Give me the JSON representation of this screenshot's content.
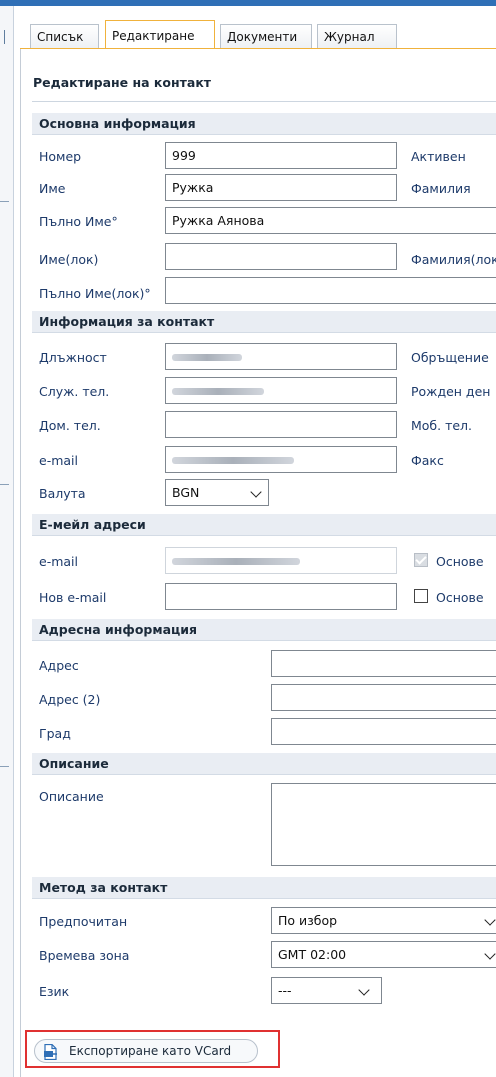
{
  "tabs": [
    "Списък",
    "Редактиране",
    "Документи",
    "Журнал"
  ],
  "page_title": "Редактиране на контакт",
  "sections": {
    "basic": "Основна информация",
    "contact": "Информация за контакт",
    "emails": "Е-мейл адреси",
    "address": "Адресна информация",
    "description": "Описание",
    "contact_method": "Метод за контакт"
  },
  "basic": {
    "number_label": "Номер",
    "number_value": "999",
    "active_label": "Активен",
    "first_name_label": "Име",
    "first_name_value": "Ружка",
    "last_name_label": "Фамилия",
    "full_name_label": "Пълно Име°",
    "full_name_value": "Ружка Аянова",
    "first_name_loc_label": "Име(лок)",
    "first_name_loc_value": "",
    "last_name_loc_label": "Фамилия(лок",
    "full_name_loc_label": "Пълно Име(лок)°",
    "full_name_loc_value": ""
  },
  "contact": {
    "position_label": "Длъжност",
    "salutation_label": "Обръщение",
    "work_phone_label": "Служ. тел.",
    "birthday_label": "Рожден ден",
    "home_phone_label": "Дом. тел.",
    "home_phone_value": "",
    "mobile_label": "Моб. тел.",
    "email_label": "e-mail",
    "fax_label": "Факс",
    "currency_label": "Валута",
    "currency_value": "BGN"
  },
  "emails": {
    "email_label": "e-mail",
    "primary_label": "Основе",
    "primary_checked": true,
    "new_email_label": "Нов e-mail",
    "new_email_value": "",
    "new_primary_label": "Основе",
    "new_primary_checked": false
  },
  "address": {
    "address_label": "Адрес",
    "address_value": "",
    "address2_label": "Адрес (2)",
    "address2_value": "",
    "city_label": "Град",
    "city_value": ""
  },
  "description": {
    "label": "Описание",
    "value": ""
  },
  "contact_method": {
    "preferred_label": "Предпочитан",
    "preferred_value": "По избор",
    "timezone_label": "Времева зона",
    "timezone_value": "GMT 02:00",
    "language_label": "Език",
    "language_value": "---"
  },
  "export_button": "Експортиране като VCard",
  "colors": {
    "accent": "#2f6fb6",
    "highlight": "#e03131",
    "tab_active": "#f0b23c"
  }
}
